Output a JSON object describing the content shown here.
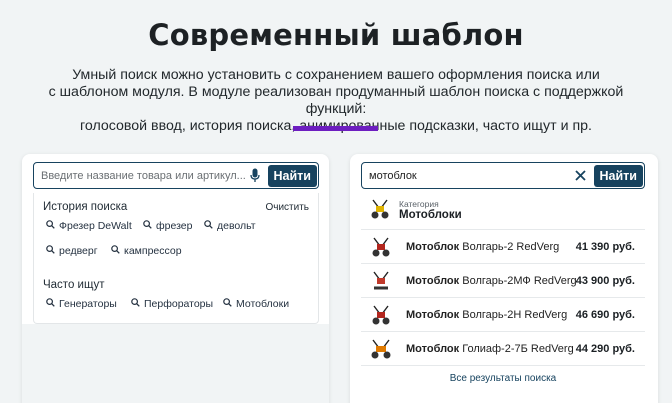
{
  "header": {
    "title": "Современный шаблон",
    "description_line1": "Умный поиск можно установить с сохранением вашего оформления поиска или",
    "description_line2": "с шаблоном модуля. В модуле реализован продуманный шаблон поиска с поддержкой функций:",
    "description_line3": "голосовой ввод, история поиска, анимированные подсказки, часто ищут и пр."
  },
  "colors": {
    "accent": "#6d1ec0",
    "primary": "#17435f",
    "background": "#f1f4f5"
  },
  "left_widget": {
    "search_placeholder": "Введите название товара или артикул...",
    "search_value": "",
    "mic_icon": "microphone-icon",
    "search_button": "Найти",
    "history_title": "История поиска",
    "clear_label": "Очистить",
    "history_items": [
      "Фрезер DeWalt",
      "фрезер",
      "девольт",
      "редверг",
      "кампрессор"
    ],
    "popular_title": "Часто ищут",
    "popular_items": [
      "Генераторы",
      "Перфораторы",
      "Мотоблоки"
    ]
  },
  "right_widget": {
    "search_value": "мотоблок",
    "clear_icon": "close-icon",
    "search_button": "Найти",
    "category_label": "Категория",
    "category_name": "Мотоблоки",
    "results": [
      {
        "bold": "Мотоблок",
        "rest": " Волгарь-2 RedVerg",
        "price": "41 390 руб."
      },
      {
        "bold": "Мотоблок",
        "rest": " Волгарь-2МФ RedVerg",
        "price": "43 900 руб."
      },
      {
        "bold": "Мотоблок",
        "rest": " Волгарь-2Н RedVerg",
        "price": "46 690 руб."
      },
      {
        "bold": "Мотоблок",
        "rest": " Голиаф-2-7Б RedVerg",
        "price": "44 290 руб."
      }
    ],
    "all_results": "Все результаты поиска"
  }
}
